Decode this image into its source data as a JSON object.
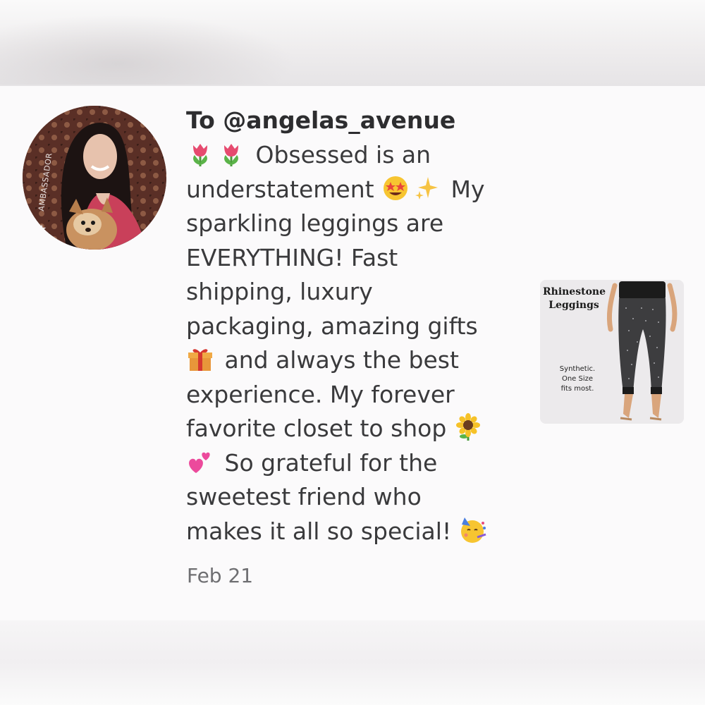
{
  "comment": {
    "to_line": "To @angelas_avenue",
    "lines": [
      "Obsessed is an",
      "understatement",
      "My",
      "sparkling leggings are",
      "EVERYTHING! Fast",
      "shipping, luxury",
      "packaging, amazing gifts",
      "and always the best",
      "experience. My forever",
      "favorite closet to shop",
      "So grateful for the",
      "sweetest friend who",
      "makes it all so special!"
    ],
    "date": "Feb 21",
    "emojis": [
      "tulip-emoji",
      "tulip-emoji",
      "star-struck-emoji",
      "sparkles-emoji",
      "gift-emoji",
      "sunflower-emoji",
      "two-hearts-emoji",
      "partying-face-emoji"
    ]
  },
  "avatar": {
    "badge_text": "AMBASSADOR"
  },
  "product": {
    "title_line1": "Rhinestone",
    "title_line2": "Leggings",
    "note_line1": "Synthetic.",
    "note_line2": "One Size",
    "note_line3": "fits most."
  },
  "colors": {
    "background": "#fbfafb",
    "text": "#3a3a3c",
    "date": "#6f6f72"
  }
}
